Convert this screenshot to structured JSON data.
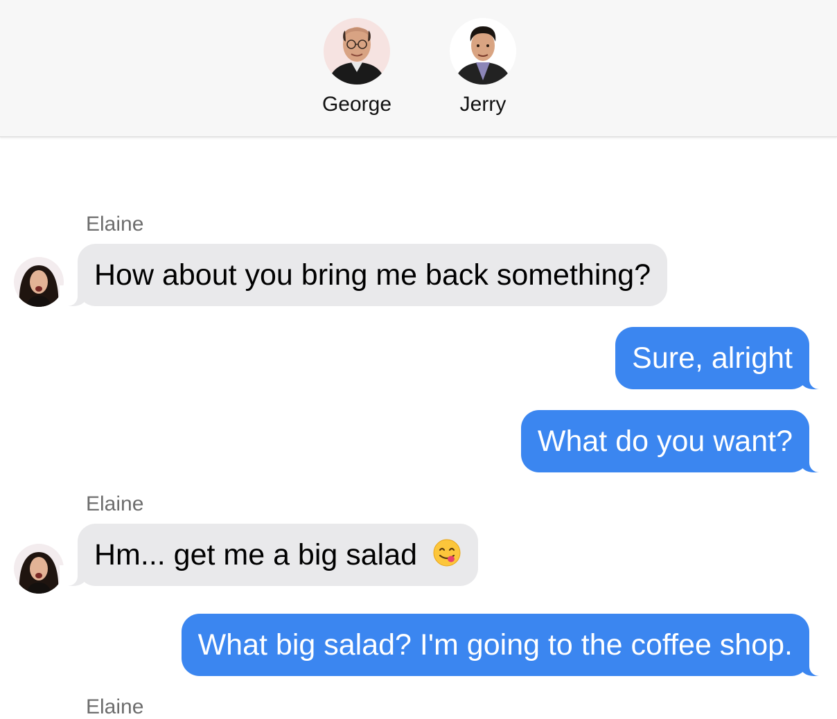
{
  "header": {
    "participants": [
      {
        "name": "George",
        "avatar_icon": "george-portrait"
      },
      {
        "name": "Jerry",
        "avatar_icon": "jerry-portrait"
      }
    ]
  },
  "conversation": {
    "messages": [
      {
        "sender": "Elaine",
        "direction": "incoming",
        "text": "How about you bring me back something?"
      },
      {
        "sender": "me",
        "direction": "outgoing",
        "text": "Sure, alright"
      },
      {
        "sender": "me",
        "direction": "outgoing",
        "text": "What do you want?"
      },
      {
        "sender": "Elaine",
        "direction": "incoming",
        "text": "Hm... get me a big salad",
        "emoji": "face-savoring-food"
      },
      {
        "sender": "me",
        "direction": "outgoing",
        "text": "What big salad? I'm going to the coffee shop."
      },
      {
        "sender": "Elaine",
        "direction": "incoming",
        "text": ""
      }
    ]
  },
  "colors": {
    "incoming_bubble": "#e9e9eb",
    "outgoing_bubble": "#3b86f0",
    "header_bg": "#f7f7f7",
    "sender_label": "#6d6d6d"
  }
}
